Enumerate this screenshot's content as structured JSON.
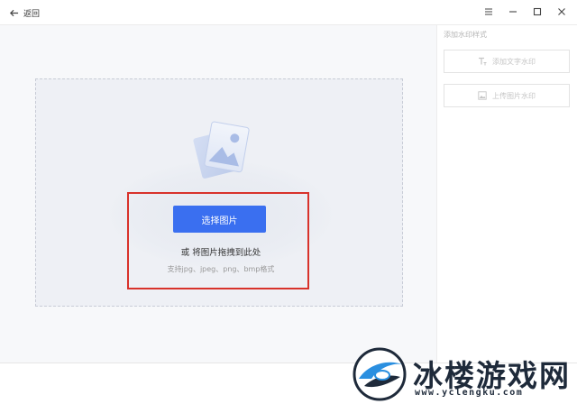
{
  "titlebar": {
    "back_label": "返回",
    "controls": [
      "menu-icon",
      "minimize-icon",
      "maximize-icon",
      "close-icon"
    ]
  },
  "upload": {
    "select_button": "选择图片",
    "drag_hint": "或 将图片拖拽到此处",
    "format_hint": "支持jpg、jpeg、png、bmp格式",
    "accent_color": "#3a6ff0",
    "highlight_color": "#d8322b"
  },
  "side_panel": {
    "title": "添加水印样式",
    "buttons": [
      {
        "label": "添加文字水印",
        "icon": "text-icon"
      },
      {
        "label": "上传图片水印",
        "icon": "image-icon"
      }
    ]
  },
  "watermark": {
    "name": "冰楼游戏网",
    "url": "www.yclengku.com"
  }
}
